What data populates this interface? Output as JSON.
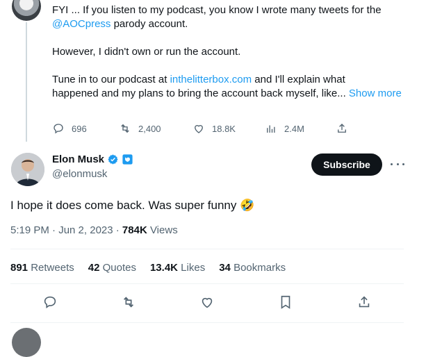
{
  "prev_tweet": {
    "line1": "FYI ... If you listen to my podcast, you know I wrote many tweets for the",
    "mention": "@AOCpress",
    "line2_rest": " parody account.",
    "para2": "However, I didn't own or run the account.",
    "para3_start": "Tune in to our podcast at ",
    "site_link": "inthelitterbox.com",
    "para3_mid": " and I'll explain what",
    "para3_line2": "happened and my plans to bring the account back myself, like... ",
    "show_more": "Show more",
    "actions": {
      "replies": "696",
      "retweets": "2,400",
      "likes": "18.8K",
      "views": "2.4M"
    }
  },
  "main_tweet": {
    "author_name": "Elon Musk",
    "author_handle": "@elonmusk",
    "subscribe_label": "Subscribe",
    "text": "I hope it does come back. Was super funny",
    "emoji": "🤣",
    "time": "5:19 PM · Jun 2, 2023 · ",
    "views_count": "784K",
    "views_label": " Views",
    "stats": {
      "retweets_count": "891",
      "retweets_label": "Retweets",
      "quotes_count": "42",
      "quotes_label": "Quotes",
      "likes_count": "13.4K",
      "likes_label": "Likes",
      "bookmarks_count": "34",
      "bookmarks_label": "Bookmarks"
    }
  },
  "colors": {
    "accent": "#1d9bf0",
    "muted": "#536471",
    "text": "#0f1419",
    "divider": "#eff3f4"
  }
}
